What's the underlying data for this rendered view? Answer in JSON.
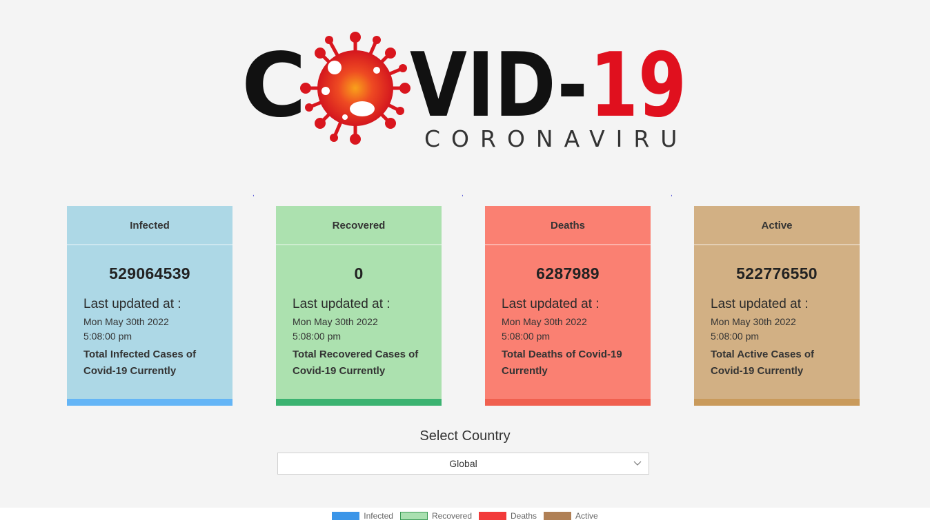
{
  "logo": {
    "title_part1": "C",
    "title_part2": "VID-",
    "title_part3": "19",
    "subtitle": "CORONAVIRUS"
  },
  "separators": [
    ",",
    ",",
    ","
  ],
  "cards": [
    {
      "title": "Infected",
      "count": "529064539",
      "updated_label": "Last updated at :",
      "date": "Mon May 30th 2022",
      "time": "5:08:00 pm",
      "description": "Total Infected Cases of Covid-19 Currently",
      "bg": "#add8e6",
      "bar": "#64b5f6"
    },
    {
      "title": "Recovered",
      "count": "0",
      "updated_label": "Last updated at :",
      "date": "Mon May 30th 2022",
      "time": "5:08:00 pm",
      "description": "Total Recovered Cases of Covid-19 Currently",
      "bg": "#ace1af",
      "bar": "#3cb371"
    },
    {
      "title": "Deaths",
      "count": "6287989",
      "updated_label": "Last updated at :",
      "date": "Mon May 30th 2022",
      "time": "5:08:00 pm",
      "description": "Total Deaths of Covid-19 Currently",
      "bg": "#fa8072",
      "bar": "#f0604f"
    },
    {
      "title": "Active",
      "count": "522776550",
      "updated_label": "Last updated at :",
      "date": "Mon May 30th 2022",
      "time": "5:08:00 pm",
      "description": "Total Active Cases of Covid-19 Currently",
      "bg": "#d2b084",
      "bar": "#c99a5b"
    }
  ],
  "country_select": {
    "label": "Select Country",
    "value": "Global",
    "icon": "chevron-down-icon"
  },
  "legend": [
    {
      "label": "Infected",
      "fill": "#3b95e8",
      "border": "#3b95e8"
    },
    {
      "label": "Recovered",
      "fill": "#a9e0b0",
      "border": "#3a9a55"
    },
    {
      "label": "Deaths",
      "fill": "#f23a3a",
      "border": "#f23a3a"
    },
    {
      "label": "Active",
      "fill": "#b08055",
      "border": "#b08055"
    }
  ]
}
